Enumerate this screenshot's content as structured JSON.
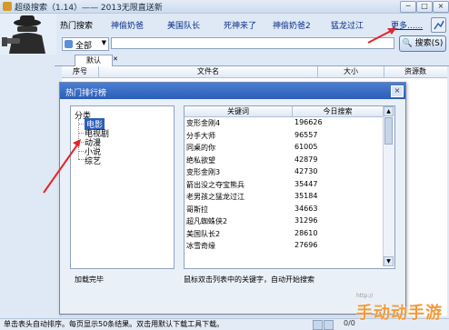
{
  "window": {
    "title": "超级搜索（1.14）—— 2013无限直送新",
    "controls": [
      "─",
      "□",
      "×"
    ]
  },
  "menu": {
    "items": [
      "热门搜索",
      "神偷奶爸",
      "美国队长",
      "死神来了",
      "神偷奶爸2",
      "猛龙过江"
    ],
    "more": "更多......"
  },
  "search": {
    "scope_value": "全部",
    "input_value": "",
    "button_label": "搜索(S)"
  },
  "results": {
    "tab_label": "默认",
    "columns": [
      "序号",
      "文件名",
      "大小",
      "资源数"
    ]
  },
  "dialog": {
    "title": "热门排行榜",
    "close": "×",
    "tree": {
      "root": "分类",
      "children": [
        "电影",
        "电视剧",
        "动漫",
        "小说",
        "综艺"
      ],
      "selected": "电影"
    },
    "table": {
      "headers": [
        "关键词",
        "今日搜索"
      ],
      "rows": [
        {
          "keyword": "变形金刚4",
          "count": "196626"
        },
        {
          "keyword": "分手大师",
          "count": "96557"
        },
        {
          "keyword": "同桌的你",
          "count": "61005"
        },
        {
          "keyword": "绝私欲望",
          "count": "42879"
        },
        {
          "keyword": "变形金刚3",
          "count": "42730"
        },
        {
          "keyword": "箭出没之夺宝熊兵",
          "count": "35447"
        },
        {
          "keyword": "老男孩之猛龙过江",
          "count": "35184"
        },
        {
          "keyword": "哥斯拉",
          "count": "34663"
        },
        {
          "keyword": "超凡蜘蛛侠2",
          "count": "31296"
        },
        {
          "keyword": "美国队长2",
          "count": "28610"
        },
        {
          "keyword": "冰雪奇缘",
          "count": "27696"
        },
        {
          "keyword": "",
          "count": ""
        }
      ]
    },
    "status_left": "加载完毕",
    "status_right": "鼠标双击列表中的关键字，自动开始搜索"
  },
  "statusbar": {
    "text": "单击表头自动排序。每页显示50条结果。双击用默认下载工具下载。",
    "page": "0/0"
  },
  "watermark": {
    "text": "手动动手游",
    "small": "http://"
  },
  "colors": {
    "dialog_title": "#2a5db8",
    "arrow": "#e3262a",
    "watermark": "#f39a3b"
  }
}
